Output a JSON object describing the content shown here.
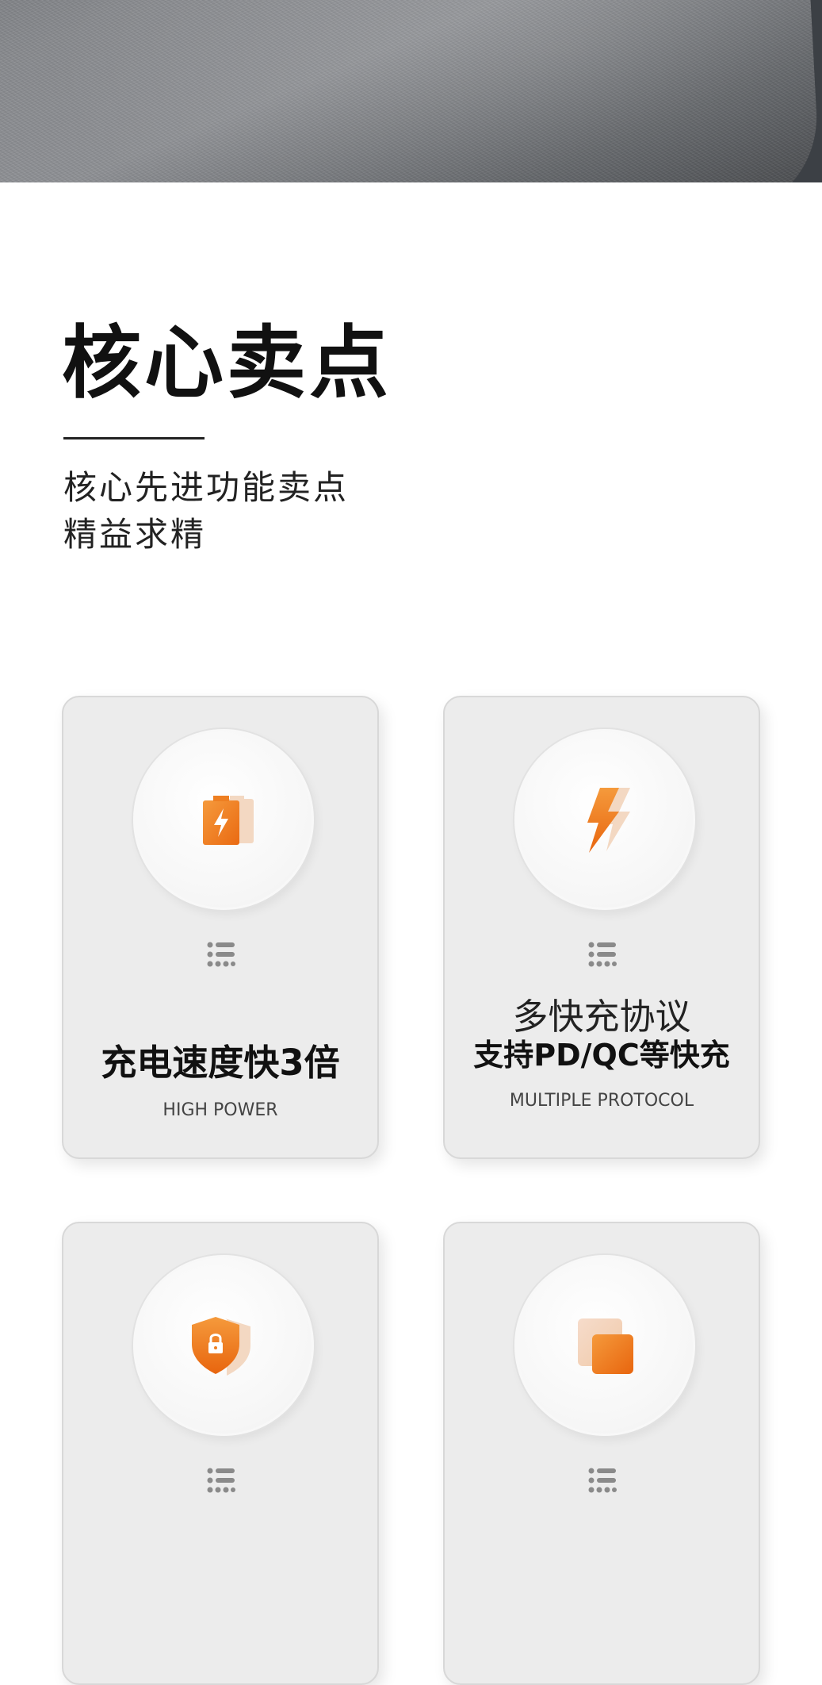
{
  "header": {
    "title": "核心卖点",
    "subtitle_line1": "核心先进功能卖点",
    "subtitle_line2": "精益求精"
  },
  "colors": {
    "accent_orange": "#f07a1a",
    "card_bg": "#ececec"
  },
  "features": [
    {
      "icon": "battery-bolt-icon",
      "title": "充电速度快3倍",
      "subtitle": "HIGH POWER"
    },
    {
      "icon": "lightning-bolt-icon",
      "title_line1": "多快充协议",
      "title_line2": "支持PD/QC等快充",
      "subtitle": "MULTIPLE PROTOCOL"
    },
    {
      "icon": "shield-lock-icon"
    },
    {
      "icon": "layered-squares-icon"
    }
  ]
}
